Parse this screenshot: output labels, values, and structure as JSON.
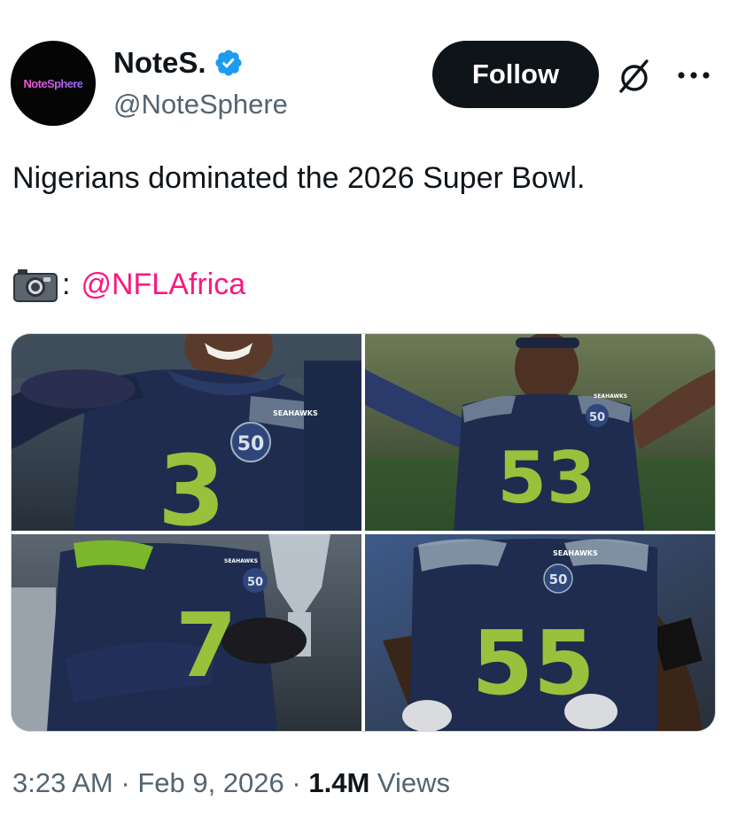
{
  "author": {
    "avatar_text": "NoteSphere",
    "display_name": "NoteS.",
    "handle": "@NoteSphere",
    "verified_icon": "verified-badge-icon"
  },
  "header": {
    "follow_label": "Follow",
    "grok_icon": "grok-icon",
    "more_icon": "more-icon"
  },
  "tweet": {
    "text": "Nigerians dominated the 2026 Super Bowl.",
    "camera_icon": "camera-icon",
    "colon": ":",
    "mention": "@NFLAfrica"
  },
  "media": {
    "photos": [
      {
        "jersey_number": "3",
        "jersey_text": "SEAHAWKS",
        "badge": "50"
      },
      {
        "jersey_number": "53",
        "jersey_text": "SEAHAWKS",
        "badge": "50"
      },
      {
        "jersey_number": "7",
        "jersey_text": "SEAHAWKS",
        "badge": "50"
      },
      {
        "jersey_number": "55",
        "jersey_text": "SEAHAWKS",
        "badge": "50"
      }
    ]
  },
  "meta": {
    "time": "3:23 AM",
    "sep1": " · ",
    "date": "Feb 9, 2026",
    "sep2": " · ",
    "views_count": "1.4M",
    "views_label": " Views"
  },
  "colors": {
    "accent_mention": "#f91880",
    "verified": "#1d9bf0",
    "text_primary": "#0f1419",
    "text_secondary": "#536471",
    "jersey_navy": "#1f2c4f",
    "jersey_green": "#9bc03b"
  }
}
